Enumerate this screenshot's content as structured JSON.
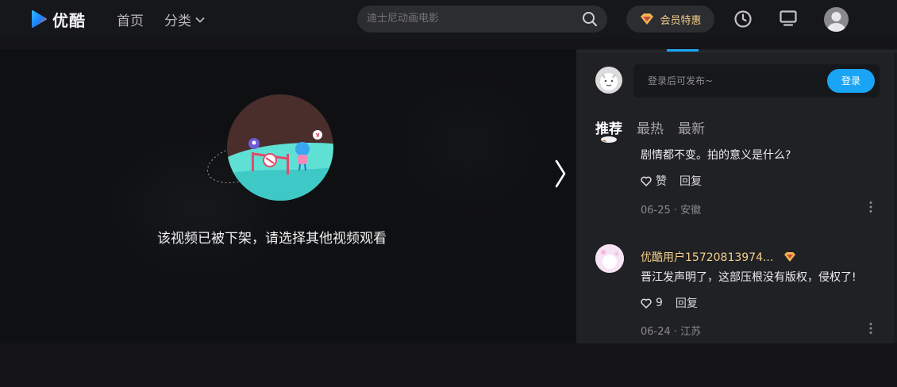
{
  "header": {
    "logo_text": "优酷",
    "nav_home": "首页",
    "nav_category": "分类",
    "search_placeholder": "迪士尼动画电影",
    "vip_label": "会员特惠"
  },
  "player": {
    "offline_message": "该视频已被下架，请选择其他视频观看"
  },
  "comments_panel": {
    "input_placeholder": "登录后可发布~",
    "login_button": "登录",
    "sort_tabs": [
      "推荐",
      "最热",
      "最新"
    ],
    "comments": [
      {
        "username": "",
        "text": "剧情都不变。拍的意义是什么?",
        "like_label": "赞",
        "reply_label": "回复",
        "meta": "06-25 · 安徽"
      },
      {
        "username": "优酷用户15720813974...",
        "text": "晋江发声明了，这部压根没有版权，侵权了!",
        "like_label": "9",
        "reply_label": "回复",
        "meta": "06-24 · 江苏"
      }
    ]
  },
  "colors": {
    "accent_blue": "#1aa4f5",
    "vip_gold": "#f3cf8a"
  }
}
